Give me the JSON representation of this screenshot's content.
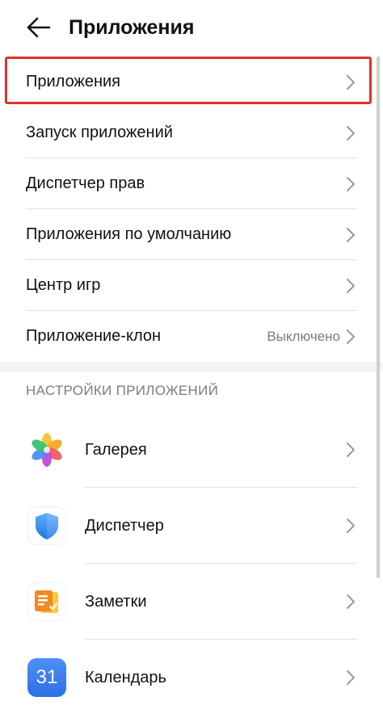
{
  "header": {
    "title": "Приложения"
  },
  "menu": {
    "items": [
      {
        "label": "Приложения",
        "value": ""
      },
      {
        "label": "Запуск приложений",
        "value": ""
      },
      {
        "label": "Диспетчер прав",
        "value": ""
      },
      {
        "label": "Приложения по умолчанию",
        "value": ""
      },
      {
        "label": "Центр игр",
        "value": ""
      },
      {
        "label": "Приложение-клон",
        "value": "Выключено"
      }
    ]
  },
  "section": {
    "title": "НАСТРОЙКИ ПРИЛОЖЕНИЙ"
  },
  "apps": {
    "items": [
      {
        "label": "Галерея",
        "icon": "gallery-icon"
      },
      {
        "label": "Диспетчер",
        "icon": "optimizer-shield-icon"
      },
      {
        "label": "Заметки",
        "icon": "notes-icon"
      },
      {
        "label": "Календарь",
        "icon": "calendar-icon",
        "icon_text": "31"
      }
    ]
  },
  "colors": {
    "highlight": "#e0302a",
    "calendar": "#2f6fe6",
    "shield": "#2e8cf0",
    "notes": "#f39a1c"
  }
}
